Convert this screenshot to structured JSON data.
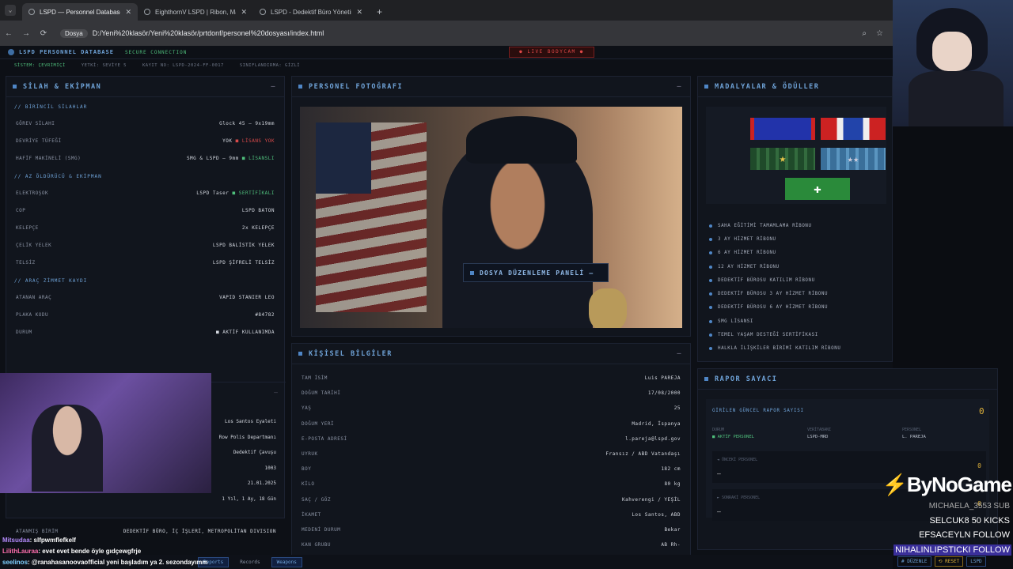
{
  "browser": {
    "tabs": [
      {
        "title": "LSPD — Personnel Database"
      },
      {
        "title": "EighthornV LSPD | Ribon, Mada"
      },
      {
        "title": "LSPD - Dedektif Büro Yönetim P"
      }
    ],
    "address_scheme": "Dosya",
    "url": "D:/Yeni%20klasör/Yeni%20klasör/prtdonf/personel%20dosyası/index.html"
  },
  "header": {
    "brand": "LSPD PERSONNEL DATABASE",
    "secure": "SECURE CONNECTION",
    "live": "● LIVE BODYCAM ●",
    "status": [
      "SİSTEM: ÇEVRİMİÇİ",
      "YETKİ: SEVİYE 5",
      "KAYIT NO: LSPD-2024-FF-0017",
      "SINIFLANDIRMA: GİZLİ"
    ]
  },
  "weapons": {
    "title": "SİLAH & EKİPMAN",
    "s1": "// BİRİNCİL SİLAHLAR",
    "r1": [
      {
        "k": "GÖREV SİLAHI",
        "v": "Glock 45 — 9x19mm"
      },
      {
        "k": "DEVRİYE TÜFEĞİ",
        "v": "YOK",
        "tag": "LİSANS YOK"
      },
      {
        "k": "HAFİF MAKİNELİ (SMG)",
        "v": "SMG & LSPD — 9mm",
        "tag": "LİSANSLI"
      }
    ],
    "s2": "// AZ ÖLDÜRÜCÜ & EKİPMAN",
    "r2": [
      {
        "k": "ELEKTROŞOK",
        "v": "LSPD Taser",
        "tag": "SERTİFİKALI"
      },
      {
        "k": "COP",
        "v": "LSPD BATON"
      },
      {
        "k": "KELEPÇE",
        "v": "2x KELEPÇE"
      },
      {
        "k": "ÇELİK YELEK",
        "v": "LSPD BALİSTİK YELEK"
      },
      {
        "k": "TELSİZ",
        "v": "LSPD ŞİFRELİ TELSİZ"
      }
    ],
    "s3": "// ARAÇ ZİMMET KAYDI",
    "r3": [
      {
        "k": "ATANAN ARAÇ",
        "v": "VAPID STANIER LEO"
      },
      {
        "k": "PLAKA KODU",
        "v": "#84782"
      },
      {
        "k": "DURUM",
        "v": "AKTİF KULLANIMDA"
      }
    ]
  },
  "service": {
    "values": [
      "Los Santos Eyaleti",
      "Row Polis Departmanı",
      "Dedektif Çavuşu",
      "1003",
      "21.01.2025",
      "1 Yıl, 1 Ay, 18 Gün"
    ],
    "unit_label": "ATANMIŞ BİRİM",
    "unit": "DEDEKTİF BÜRO, İÇ İŞLERİ, METROPOLİTAN DIVISION"
  },
  "photo": {
    "title": "PERSONEL FOTOĞRAFI",
    "edit": "DOSYA DÜZENLEME PANELİ"
  },
  "personal": {
    "title": "KİŞİSEL BİLGİLER",
    "rows": [
      {
        "k": "TAM İSİM",
        "v": "Luis PAREJA"
      },
      {
        "k": "DOĞUM TARİHİ",
        "v": "17/08/2000"
      },
      {
        "k": "YAŞ",
        "v": "25"
      },
      {
        "k": "DOĞUM YERİ",
        "v": "Madrid, İspanya"
      },
      {
        "k": "E-POSTA ADRESİ",
        "v": "l.pareja@lspd.gov"
      },
      {
        "k": "UYRUK",
        "v": "Fransız / ABD Vatandaşı"
      },
      {
        "k": "BOY",
        "v": "182 cm"
      },
      {
        "k": "KİLO",
        "v": "80 kg"
      },
      {
        "k": "SAÇ / GÖZ",
        "v": "Kahverengi / YEŞİL"
      },
      {
        "k": "İKAMET",
        "v": "Los Santos, ABD"
      },
      {
        "k": "MEDENİ DURUM",
        "v": "Bekar"
      },
      {
        "k": "KAN GRUBU",
        "v": "AB Rh-"
      }
    ]
  },
  "medals": {
    "title": "MADALYALAR & ÖDÜLLER",
    "list": [
      "SAHA EĞİTİMİ TAMAMLAMA RİBONU",
      "3 AY HİZMET RİBONU",
      "6 AY HİZMET RİBONU",
      "12 AY HİZMET RİBONU",
      "DEDEKTİF BÜROSU KATILIM RİBONU",
      "DEDEKTİF BÜROSU 3 AY HİZMET RİBONU",
      "DEDEKTİF BÜROSU 6 AY HİZMET RİBONU",
      "SMG LİSANSI",
      "TEMEL YAŞAM DESTEĞİ SERTİFİKASI",
      "HALKLA İLİŞKİLER BİRİMİ KATILIM RİBONU"
    ]
  },
  "report": {
    "title": "RAPOR SAYACI",
    "label": "GİRİLEN GÜNCEL RAPOR SAYISI",
    "count": "0",
    "durum_k": "DURUM",
    "durum_v": "AKTİF PERSONEL",
    "ver_k": "VERİTABANI",
    "ver_v": "LSPD-MRD",
    "per_k": "PERSONEL",
    "per_v": "L. PAREJA",
    "prev": "◄ ÖNCEKİ PERSONEL",
    "next": "► SONRAKİ PERSONEL",
    "dash": "—",
    "zero": "0"
  },
  "overlay": {
    "brand": "ByNoGame",
    "l1": "MICHAELA_3553  SUB",
    "l2": "SELCUK8  50 KICKS",
    "l3": "EFSACEYLN  FOLLOW",
    "l4": "NIHALINLIPSTICKI  FOLLOW"
  },
  "chat": [
    {
      "user": "Mitsudaa",
      "msg": ": slfpwmflefkelf"
    },
    {
      "user": "LilithLauraa",
      "msg": ": evet evet bende öyle gıdçewgfrje"
    },
    {
      "user": "seelinos",
      "msg": ": @ranahasanoovaofficial yeni başladım ya 2. sezondayımm"
    }
  ],
  "bottom": {
    "items": [
      "Reports",
      "Records",
      "Weapons"
    ],
    "right": [
      "# DÜZENLE",
      "⟲ RESET",
      "LSPD"
    ]
  }
}
